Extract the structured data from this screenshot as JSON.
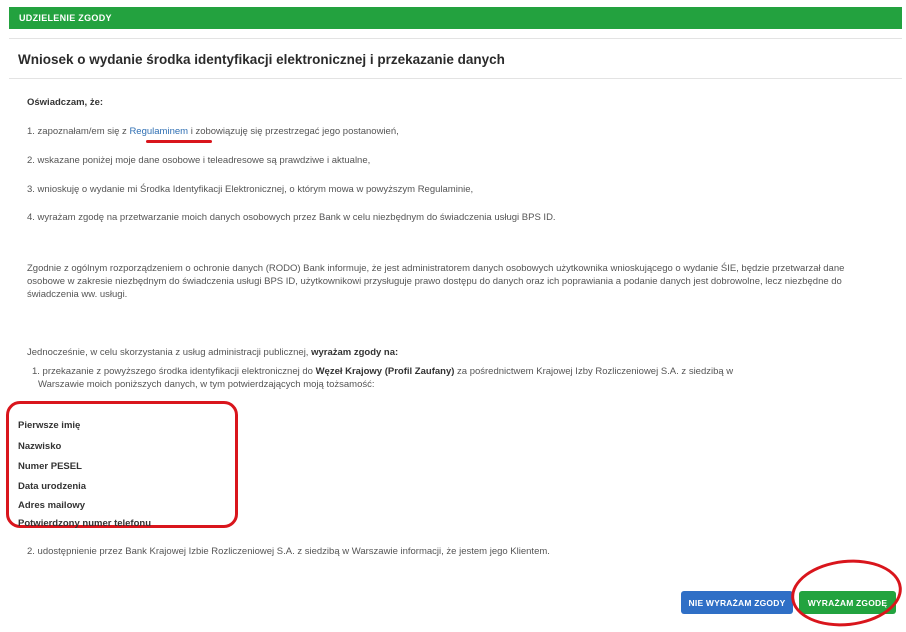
{
  "header": {
    "label": "UDZIELENIE ZGODY"
  },
  "title": "Wniosek o wydanie środka identyfikacji elektronicznej i przekazanie danych",
  "declaration": {
    "heading": "Oświadczam, że:",
    "item1_prefix": "1. zapoznałam/em się z ",
    "item1_link": "Regulaminem",
    "item1_suffix": " i zobowiązuję się przestrzegać jego postanowień,",
    "item2": "2. wskazane poniżej moje dane osobowe i teleadresowe są prawdziwe i aktualne,",
    "item3": "3. wnioskuję o wydanie mi Środka Identyfikacji Elektronicznej, o którym mowa w powyższym Regulaminie,",
    "item4": "4. wyrażam zgodę na przetwarzanie moich danych osobowych przez Bank w celu niezbędnym do świadczenia usługi BPS ID."
  },
  "gdpr_notice": "Zgodnie z ogólnym rozporządzeniem o ochronie danych (RODO) Bank informuje, że jest administratorem danych osobowych użytkownika wnioskującego o wydanie ŚIE, będzie przetwarzał dane osobowe w zakresie niezbędnym do świadczenia usługi BPS ID, użytkownikowi przysługuje prawo dostępu do danych oraz ich poprawiania a podanie danych jest dobrowolne, lecz niezbędne do świadczenia ww. usługi.",
  "consent": {
    "intro_prefix": "Jednocześnie, w celu skorzystania z usług administracji publicznej, ",
    "intro_bold": "wyrażam zgody na:",
    "item1_prefix": "1. przekazanie z powyższego środka identyfikacji elektronicznej do ",
    "item1_bold": "Węzeł Krajowy (Profil Zaufany)",
    "item1_suffix": " za pośrednictwem Krajowej Izby Rozliczeniowej S.A. z siedzibą w",
    "item1_line2": "Warszawie moich poniższych danych, w tym potwierdzających moją tożsamość:",
    "item2": "2. udostępnienie przez Bank Krajowej Izbie Rozliczeniowej S.A. z siedzibą w Warszawie informacji, że jestem jego Klientem."
  },
  "data_fields": [
    "Pierwsze imię",
    "Nazwisko",
    "Numer PESEL",
    "Data urodzenia",
    "Adres mailowy",
    "Potwierdzony numer telefonu"
  ],
  "buttons": {
    "decline": "NIE WYRAŻAM ZGODY",
    "accept": "WYRAŻAM ZGODĘ"
  },
  "colors": {
    "accent_green": "#23a23f",
    "button_blue": "#2f6fc6",
    "annotation_red": "#d9151c"
  }
}
